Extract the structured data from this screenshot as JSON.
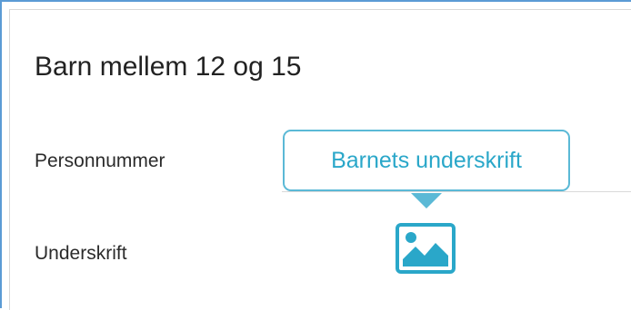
{
  "section": {
    "title": "Barn mellem 12 og 15"
  },
  "fields": {
    "personnummer_label": "Personnummer",
    "underskrift_label": "Underskrift"
  },
  "tooltip": {
    "text": "Barnets underskrift"
  },
  "icons": {
    "signature_image": "image-icon"
  },
  "colors": {
    "accent": "#2aa7c9",
    "tooltip_border": "#5bb9d6",
    "frame_border": "#5b9bd5"
  }
}
